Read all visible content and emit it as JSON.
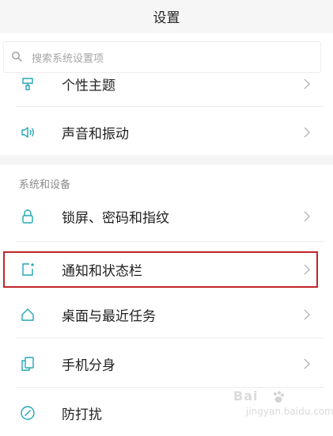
{
  "header": {
    "title": "设置"
  },
  "search": {
    "placeholder": "搜索系统设置项",
    "icon": "search-icon"
  },
  "items_top": [
    {
      "label": "个性主题",
      "icon": "theme-brush-icon"
    },
    {
      "label": "声音和振动",
      "icon": "speaker-icon"
    }
  ],
  "section": {
    "title": "系统和设备"
  },
  "items_system": [
    {
      "label": "锁屏、密码和指纹",
      "icon": "lock-icon"
    },
    {
      "label": "通知和状态栏",
      "icon": "notification-icon",
      "highlighted": true
    },
    {
      "label": "桌面与最近任务",
      "icon": "home-icon"
    },
    {
      "label": "手机分身",
      "icon": "clone-icon"
    },
    {
      "label": "防打扰",
      "icon": "do-not-disturb-icon"
    }
  ],
  "watermark": {
    "main": "Bai",
    "sub": "jingyan.baidu.com"
  },
  "colors": {
    "accent": "#23a6b5",
    "highlight_border": "#c0262b",
    "text_primary": "#1f1f1f",
    "text_secondary": "#8a8a8a"
  }
}
